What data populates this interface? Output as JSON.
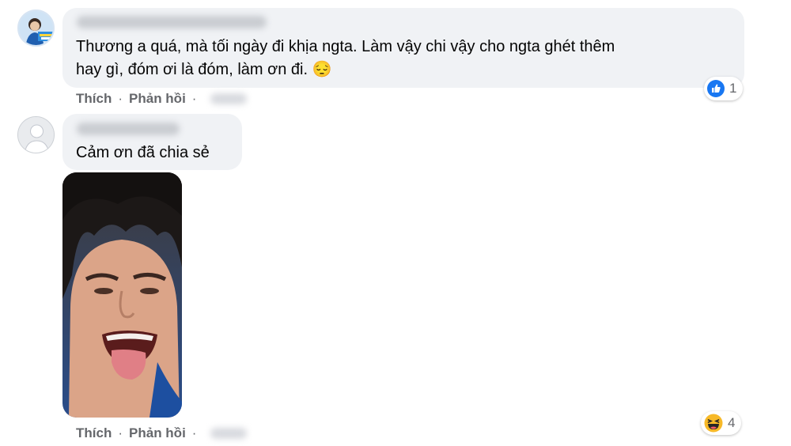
{
  "comments": [
    {
      "text_line1": "Thương a quá, mà tối ngày đi khịa ngta. Làm vậy chi vậy cho ngta ghét thêm",
      "text_line2": "hay gì, đóm ơi là đóm, làm ơn đi. 😔",
      "actions": {
        "like": "Thích",
        "reply": "Phản hồi",
        "separator": "·"
      },
      "reaction": {
        "icon": "like-icon",
        "count": "1"
      }
    },
    {
      "text": "Cảm ơn đã chia sẻ",
      "actions": {
        "like": "Thích",
        "reply": "Phản hồi",
        "separator": "·"
      },
      "reaction": {
        "icon": "laugh-icon",
        "count": "4"
      }
    }
  ],
  "colors": {
    "bubble": "#f0f2f5",
    "action_text": "#65676b",
    "like_blue": "#1877f2",
    "laugh_yellow": "#f7b928"
  }
}
